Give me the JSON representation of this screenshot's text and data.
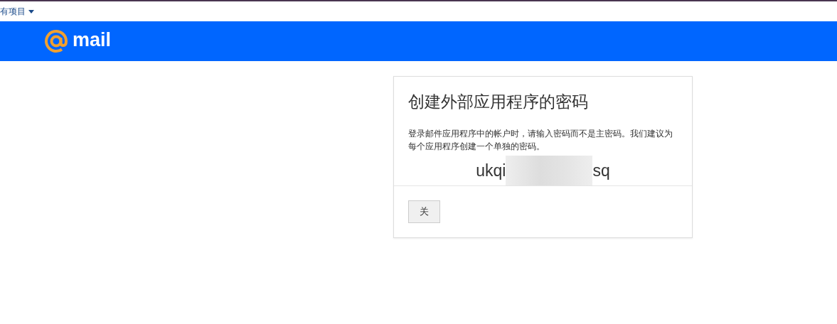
{
  "top_bar": {
    "menu_link": "有项目"
  },
  "header": {
    "logo_text": "mail"
  },
  "dialog": {
    "title": "创建外部应用程序的密码",
    "description": "登录邮件应用程序中的帐户时，请输入密码而不是主密码。我们建议为每个应用程序创建一个单独的密码。",
    "password_start": "ukqi",
    "password_end": "sq",
    "buttons": [
      "关"
    ]
  }
}
